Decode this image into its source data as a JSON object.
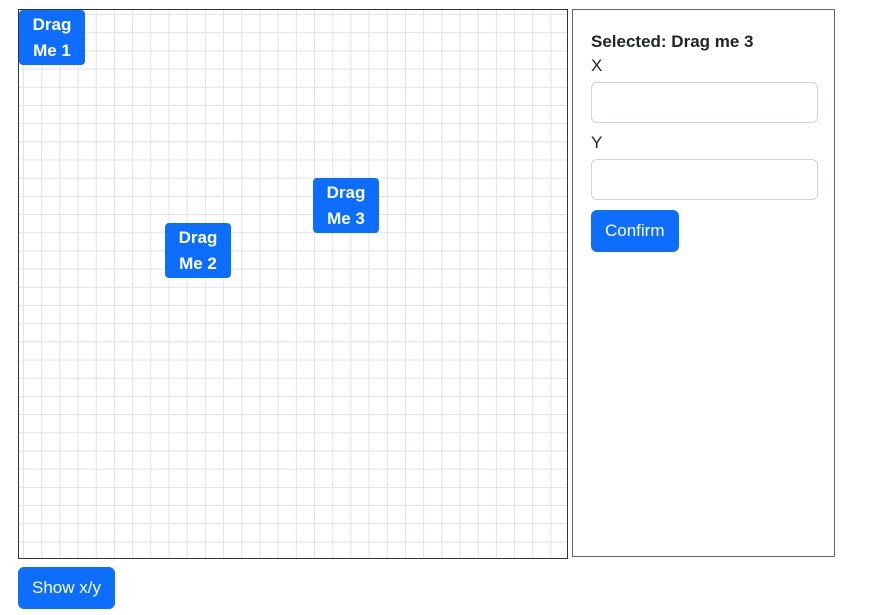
{
  "stage": {
    "draggables": [
      {
        "line1": "Drag",
        "line2": "Me 1"
      },
      {
        "line1": "Drag",
        "line2": "Me 2"
      },
      {
        "line1": "Drag",
        "line2": "Me 3"
      }
    ]
  },
  "panel": {
    "selected_text": "Selected: Drag me 3",
    "x_label": "X",
    "x_value": "",
    "y_label": "Y",
    "y_value": "",
    "confirm_label": "Confirm"
  },
  "footer": {
    "show_xy_label": "Show x/y"
  },
  "colors": {
    "accent": "#0d6efd",
    "grid_line": "#dfe2ea"
  }
}
